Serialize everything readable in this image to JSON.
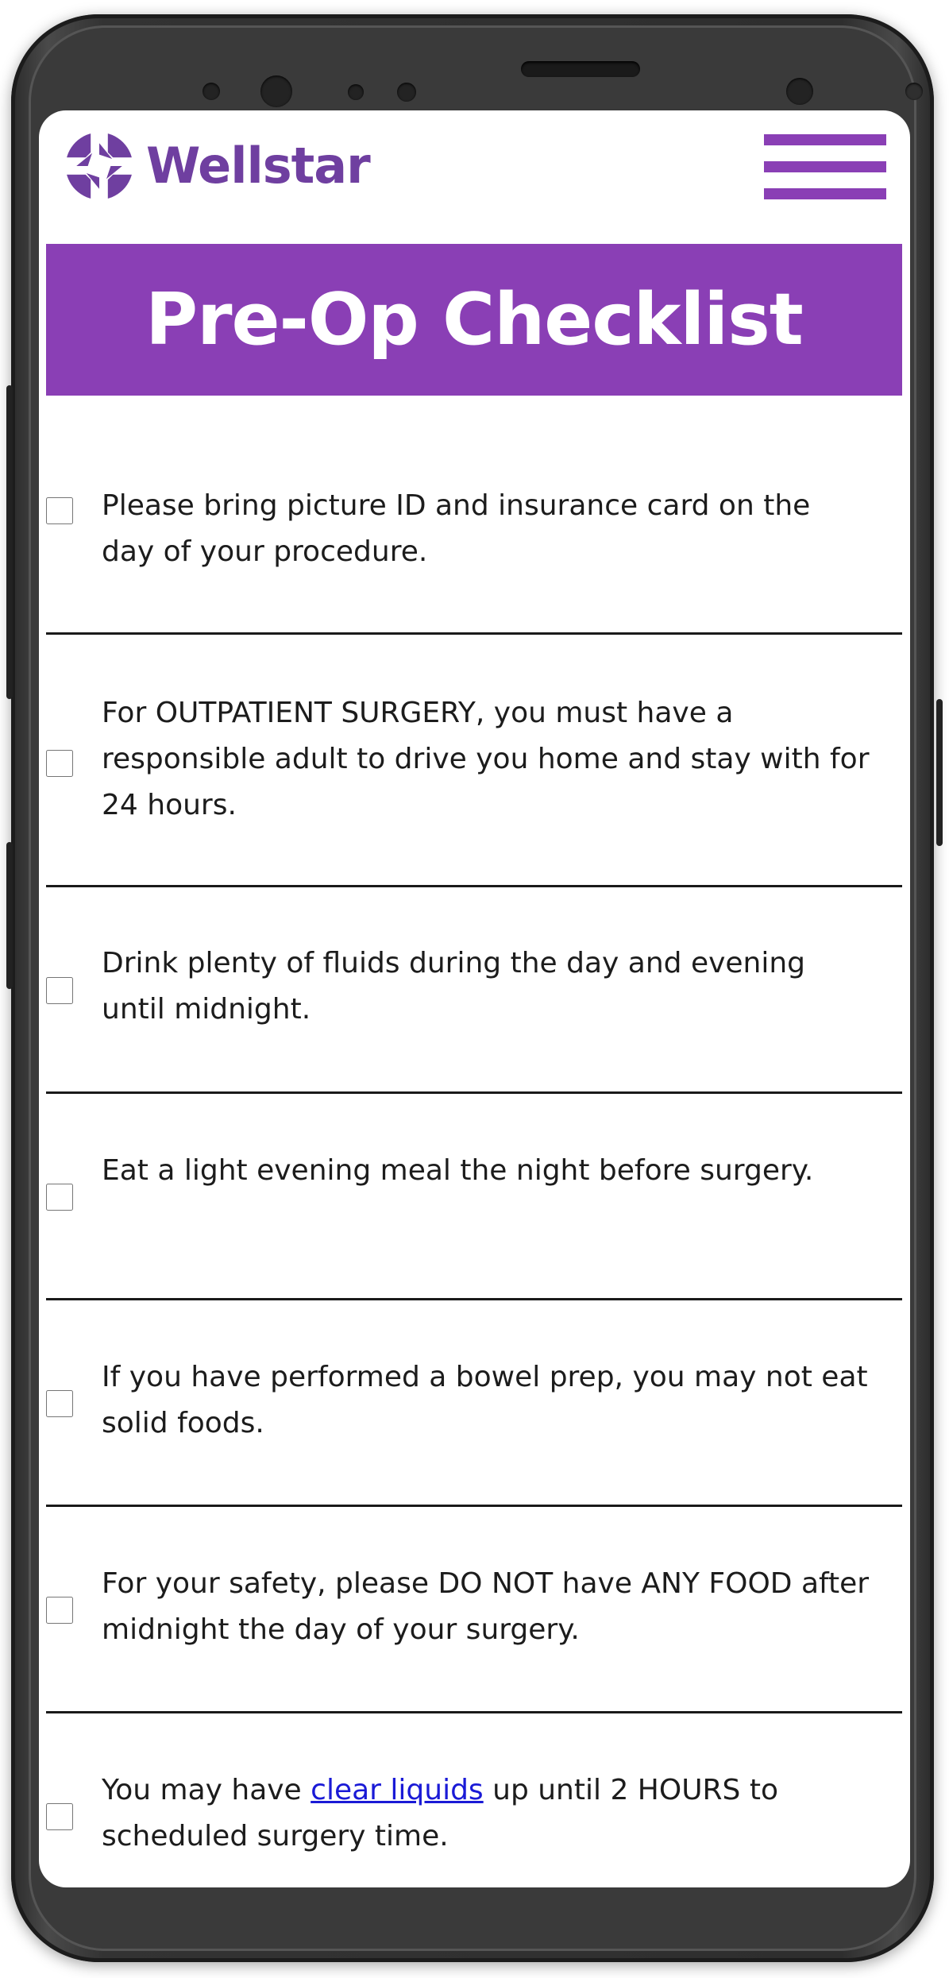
{
  "brand": {
    "name": "Wellstar",
    "color": "#6f3fa0"
  },
  "menu": {
    "icon": "hamburger-menu-icon",
    "color": "#8a3fb5"
  },
  "page_title": "Pre-Op Checklist",
  "accent": "#8a3fb5",
  "checklist": [
    {
      "text": "Please bring picture ID and insurance card on the day of your procedure.",
      "checked": false
    },
    {
      "text": "For OUTPATIENT SURGERY, you must have a responsible adult to drive you home and stay with for 24 hours.",
      "checked": false
    },
    {
      "text": "Drink plenty of fluids during the day and evening until midnight.",
      "checked": false
    },
    {
      "text": "Eat a light evening meal the night before surgery.",
      "checked": false
    },
    {
      "text": "If you have performed a bowel prep, you may not eat solid foods.",
      "checked": false
    },
    {
      "text": "For your safety, please DO NOT have ANY FOOD after midnight the day of your surgery.",
      "checked": false
    },
    {
      "text_before": "You may have ",
      "link": "clear liquids",
      "text_after": " up until 2 HOURS to scheduled surgery time.",
      "checked": false
    }
  ]
}
